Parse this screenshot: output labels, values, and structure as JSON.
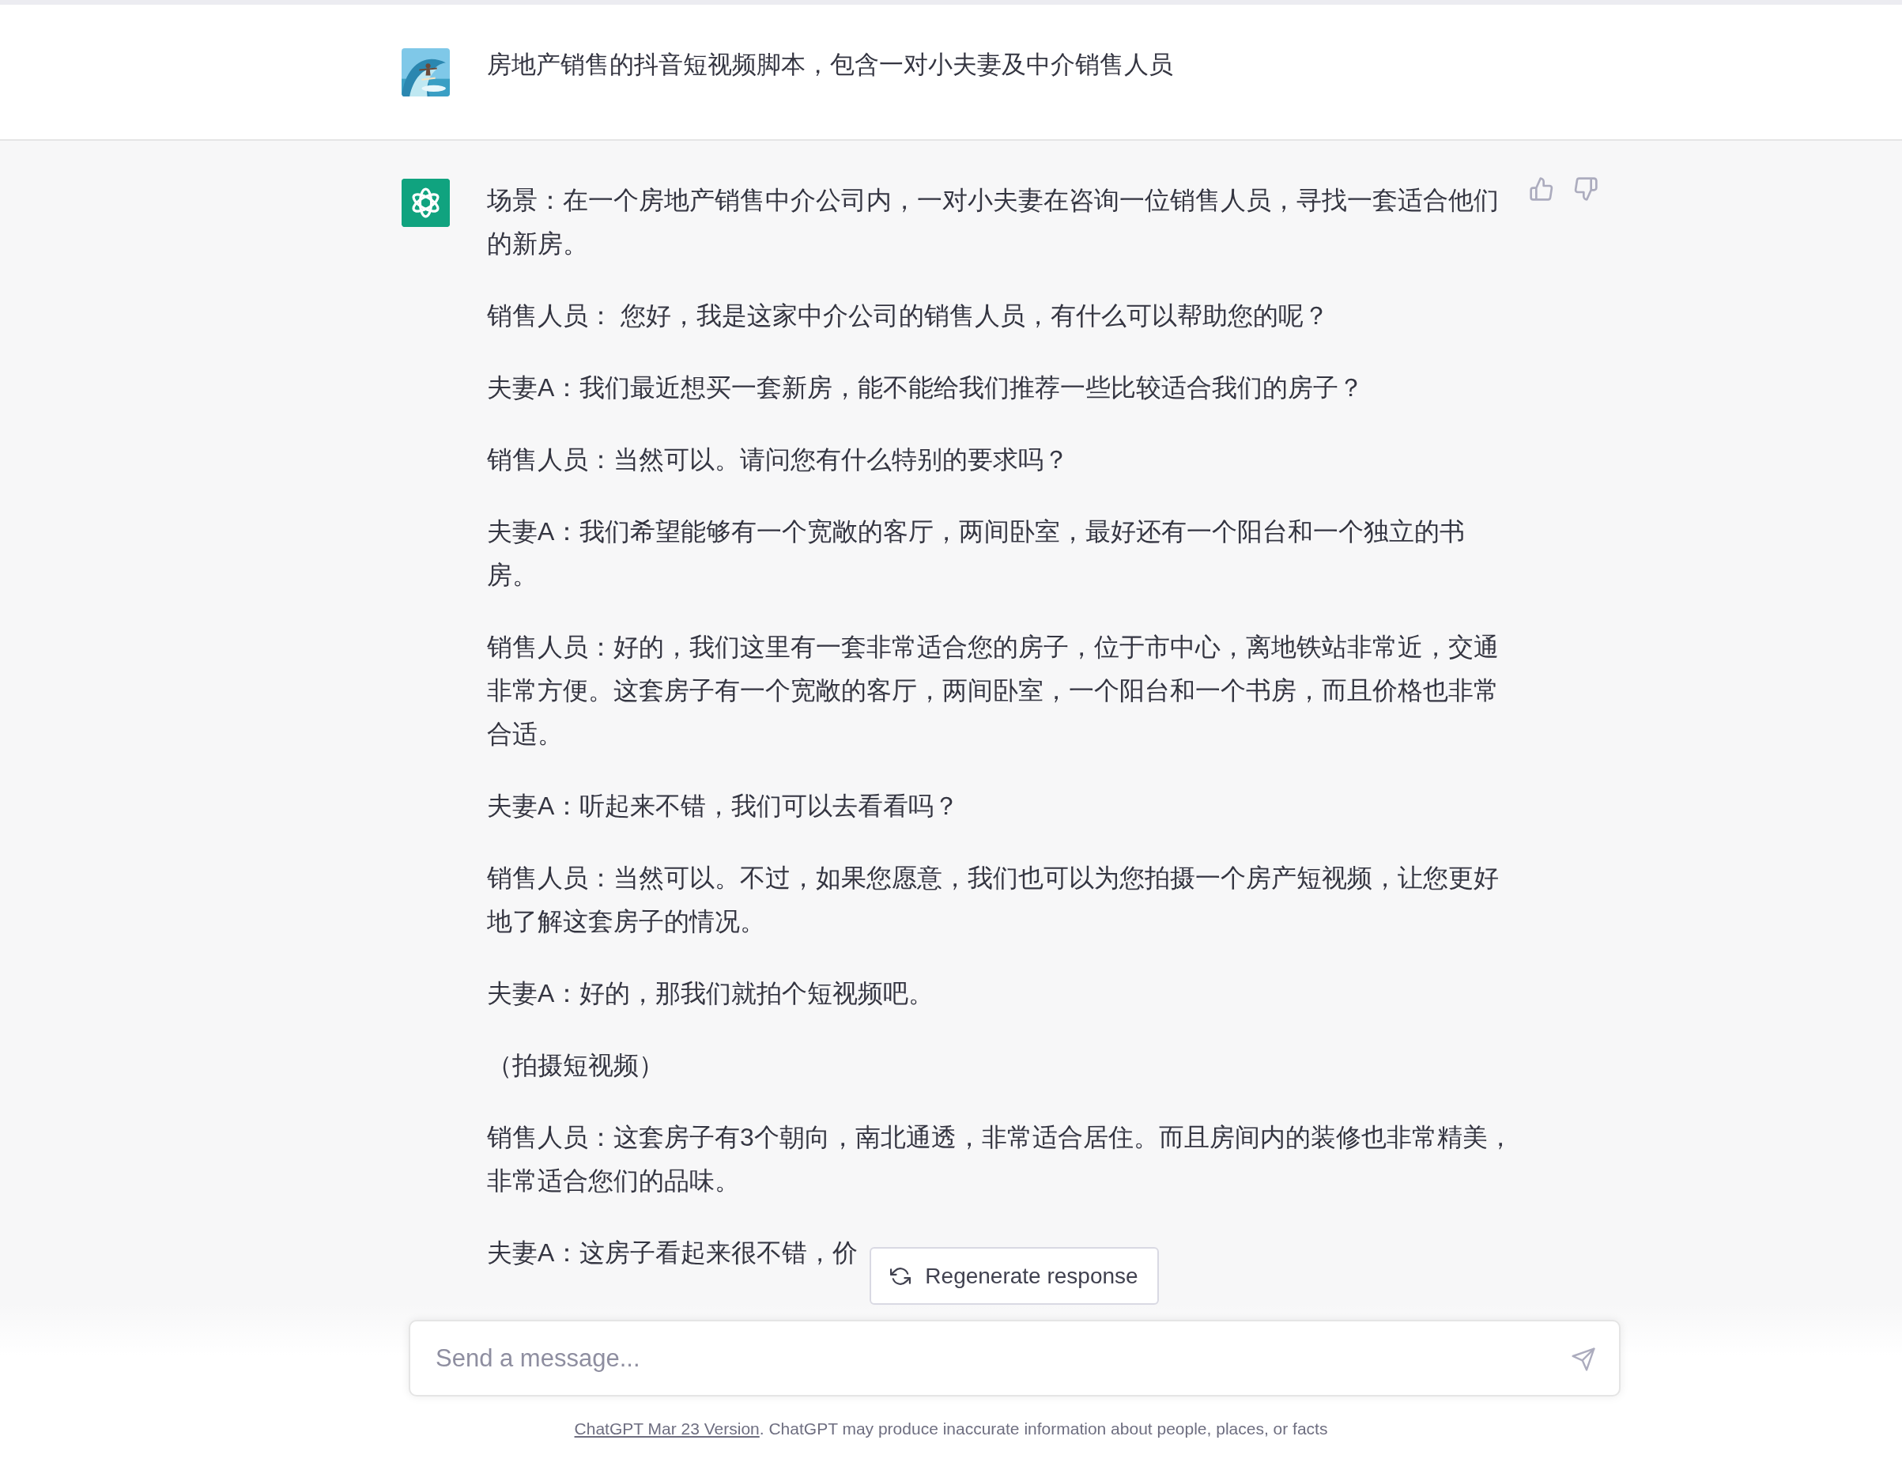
{
  "user_message": {
    "text": "房地产销售的抖音短视频脚本，包含一对小夫妻及中介销售人员"
  },
  "assistant_message": {
    "paragraphs": [
      "场景：在一个房地产销售中介公司内，一对小夫妻在咨询一位销售人员，寻找一套适合他们的新房。",
      "销售人员： 您好，我是这家中介公司的销售人员，有什么可以帮助您的呢？",
      "夫妻A：我们最近想买一套新房，能不能给我们推荐一些比较适合我们的房子？",
      "销售人员：当然可以。请问您有什么特别的要求吗？",
      "夫妻A：我们希望能够有一个宽敞的客厅，两间卧室，最好还有一个阳台和一个独立的书房。",
      "销售人员：好的，我们这里有一套非常适合您的房子，位于市中心，离地铁站非常近，交通非常方便。这套房子有一个宽敞的客厅，两间卧室，一个阳台和一个书房，而且价格也非常合适。",
      "夫妻A：听起来不错，我们可以去看看吗？",
      "销售人员：当然可以。不过，如果您愿意，我们也可以为您拍摄一个房产短视频，让您更好地了解这套房子的情况。",
      "夫妻A：好的，那我们就拍个短视频吧。",
      "（拍摄短视频）",
      "销售人员：这套房子有3个朝向，南北通透，非常适合居住。而且房间内的装修也非常精美，非常适合您们的品味。",
      "夫妻A：这房子看起来很不错，价"
    ]
  },
  "regenerate_button": {
    "label": "Regenerate response"
  },
  "composer": {
    "placeholder": "Send a message..."
  },
  "footer": {
    "link": "ChatGPT Mar 23 Version",
    "text": ". ChatGPT may produce inaccurate information about people, places, or facts"
  }
}
